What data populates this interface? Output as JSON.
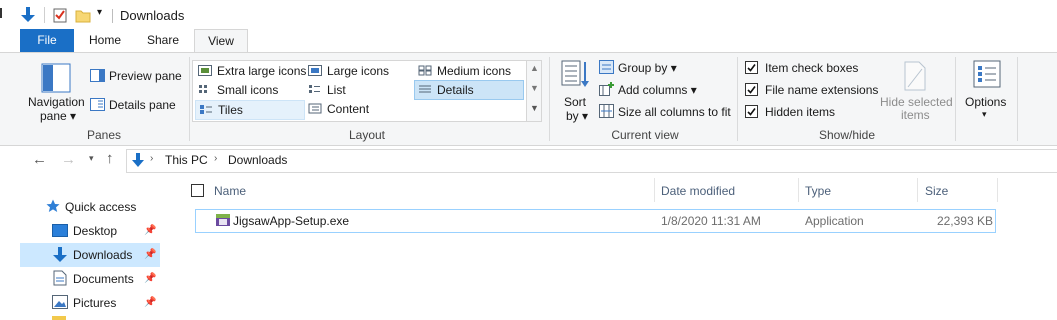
{
  "window": {
    "title": "Downloads"
  },
  "tabs": [
    "File",
    "Home",
    "Share",
    "View"
  ],
  "ribbon": {
    "panes": {
      "navigation_pane": "Navigation",
      "navigation_pane2": "pane ▾",
      "preview_pane": "Preview pane",
      "details_pane": "Details pane",
      "group_label": "Panes"
    },
    "layout": {
      "items": [
        "Extra large icons",
        "Large icons",
        "Medium icons",
        "Small icons",
        "List",
        "Details",
        "Tiles",
        "Content"
      ],
      "selected": "Details",
      "group_label": "Layout"
    },
    "current_view": {
      "sort_by": "Sort",
      "sort_by2": "by ▾",
      "group_by": "Group by ▾",
      "add_columns": "Add columns ▾",
      "size_all_columns": "Size all columns to fit",
      "group_label": "Current view"
    },
    "show_hide": {
      "item_check_boxes": "Item check boxes",
      "file_name_extensions": "File name extensions",
      "hidden_items": "Hidden items",
      "item_check_boxes_checked": true,
      "file_name_extensions_checked": true,
      "hidden_items_checked": true,
      "hide_selected": "Hide selected",
      "hide_selected2": "items",
      "group_label": "Show/hide"
    },
    "options": {
      "label": "Options",
      "arrow": "▾"
    }
  },
  "address": {
    "crumbs": [
      "This PC",
      "Downloads"
    ]
  },
  "nav": {
    "items": [
      {
        "label": "Quick access",
        "icon": "star-icon"
      },
      {
        "label": "Desktop",
        "icon": "desktop-folder-icon",
        "pinned": true
      },
      {
        "label": "Downloads",
        "icon": "download-arrow-icon",
        "pinned": true,
        "selected": true
      },
      {
        "label": "Documents",
        "icon": "documents-icon",
        "pinned": true
      },
      {
        "label": "Pictures",
        "icon": "pictures-icon",
        "pinned": true
      }
    ]
  },
  "files": {
    "columns": [
      "Name",
      "Date modified",
      "Type",
      "Size"
    ],
    "rows": [
      {
        "name": "JigsawApp-Setup.exe",
        "date": "1/8/2020 11:31 AM",
        "type": "Application",
        "size": "22,393 KB"
      }
    ]
  },
  "colors": {
    "accent": "#1a6fc6",
    "selection": "#cce8ff",
    "ribbon_bg": "#f5f6f7"
  }
}
